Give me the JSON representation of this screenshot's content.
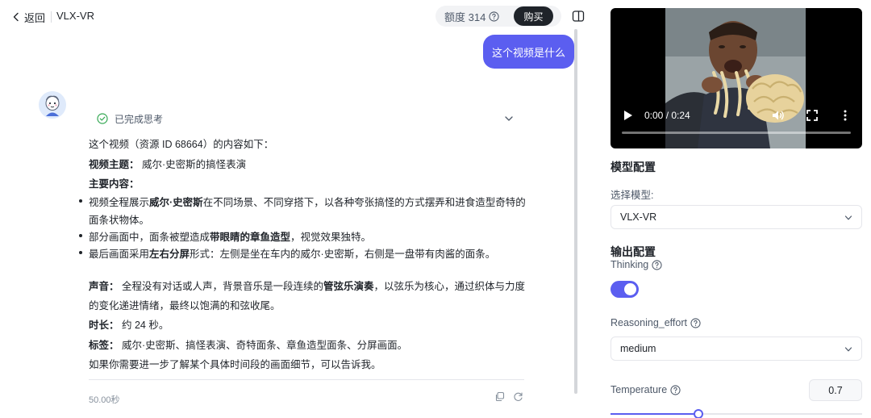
{
  "header": {
    "back_label": "返回",
    "title": "VLX-VR",
    "quota_label": "额度 314",
    "buy_label": "购买"
  },
  "chat": {
    "user_message": "这个视频是什么",
    "thinking_status": "已完成思考",
    "answer": {
      "intro": "这个视频（资源 ID 68664）的内容如下：",
      "theme_label": "视频主题：",
      "theme_value": "威尔·史密斯的搞怪表演",
      "main_label": "主要内容：",
      "b1_pre": "视频全程展示",
      "b1_bold": "威尔·史密斯",
      "b1_post": "在不同场景、不同穿搭下，以各种夸张搞怪的方式摆弄和进食造型奇特的",
      "b1_cont": "面条状物体。",
      "b2_pre": "部分画面中，面条被塑造成",
      "b2_bold": "带眼睛的章鱼造型",
      "b2_post": "，视觉效果独特。",
      "b3_pre": "最后画面采用",
      "b3_bold": "左右分屏",
      "b3_post": "形式：左侧是坐在车内的威尔·史密斯，右侧是一盘带有肉酱的面条。",
      "sound_label": "声音：",
      "sound_pre": "全程没有对话或人声，背景音乐是一段连续的",
      "sound_bold": "管弦乐演奏",
      "sound_post": "，以弦乐为核心，通过织体与力度",
      "sound_cont": "的变化递进情绪，最终以饱满的和弦收尾。",
      "duration_label": "时长：",
      "duration_value": "约 24 秒。",
      "tags_label": "标签：",
      "tags_value": "威尔·史密斯、搞怪表演、奇特面条、章鱼造型面条、分屏画面。",
      "closing": "如果你需要进一步了解某个具体时间段的画面细节，可以告诉我。"
    },
    "elapsed": "50.00秒"
  },
  "video": {
    "time_display": "0:00 / 0:24",
    "progress": 0
  },
  "config": {
    "model_section_title": "模型配置",
    "select_model_label": "选择模型:",
    "model_value": "VLX-VR",
    "output_section_title": "输出配置",
    "thinking_label": "Thinking",
    "thinking_enabled": true,
    "reasoning_label": "Reasoning_effort",
    "reasoning_value": "medium",
    "temperature_label": "Temperature",
    "temperature_value": "0.7",
    "temperature_fraction": 0.35
  },
  "colors": {
    "accent": "#5b5ef0",
    "buy_button": "#1f2329"
  },
  "icons": [
    "chevron-left-icon",
    "help-circle-icon",
    "sidebar-toggle-icon",
    "check-circle-icon",
    "chevron-down-icon",
    "copy-icon",
    "refresh-icon",
    "play-icon",
    "volume-icon",
    "fullscreen-icon",
    "more-vertical-icon"
  ]
}
